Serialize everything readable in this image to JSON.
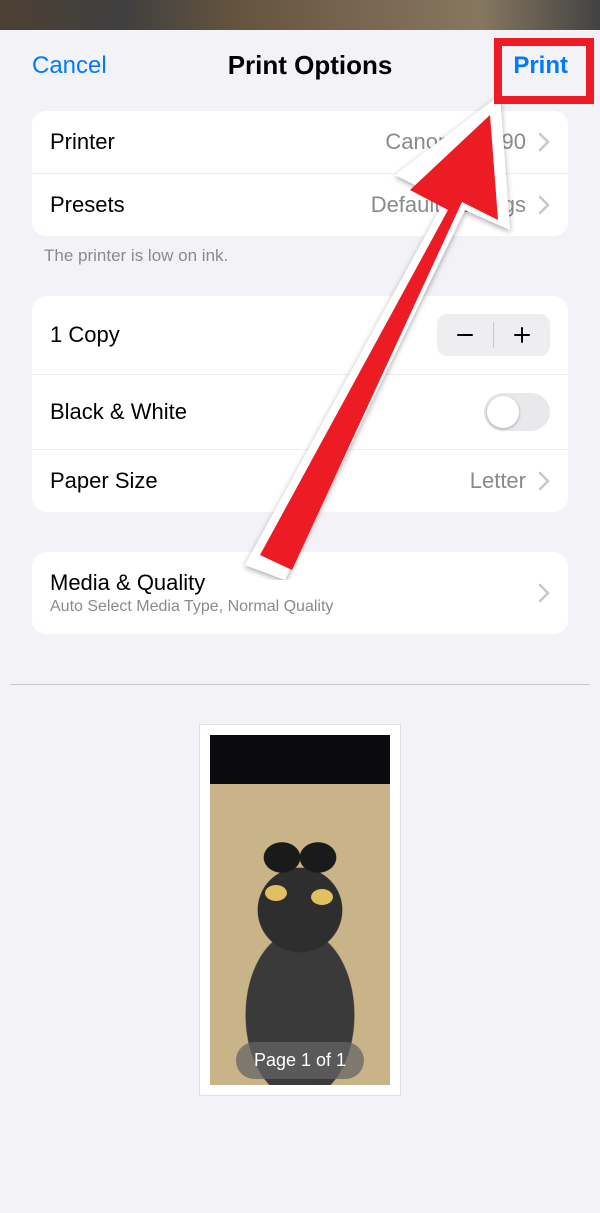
{
  "header": {
    "cancel_label": "Cancel",
    "title": "Print Options",
    "print_label": "Print"
  },
  "printer_group": {
    "printer_label": "Printer",
    "printer_value": "Canon MX490",
    "presets_label": "Presets",
    "presets_value": "Default Settings"
  },
  "printer_footnote": "The printer is low on ink.",
  "options_group": {
    "copies_label": "1 Copy",
    "bw_label": "Black & White",
    "paper_label": "Paper Size",
    "paper_value": "Letter"
  },
  "media_group": {
    "label": "Media & Quality",
    "sub": "Auto Select Media Type, Normal Quality"
  },
  "preview": {
    "page_badge": "Page 1 of 1"
  }
}
